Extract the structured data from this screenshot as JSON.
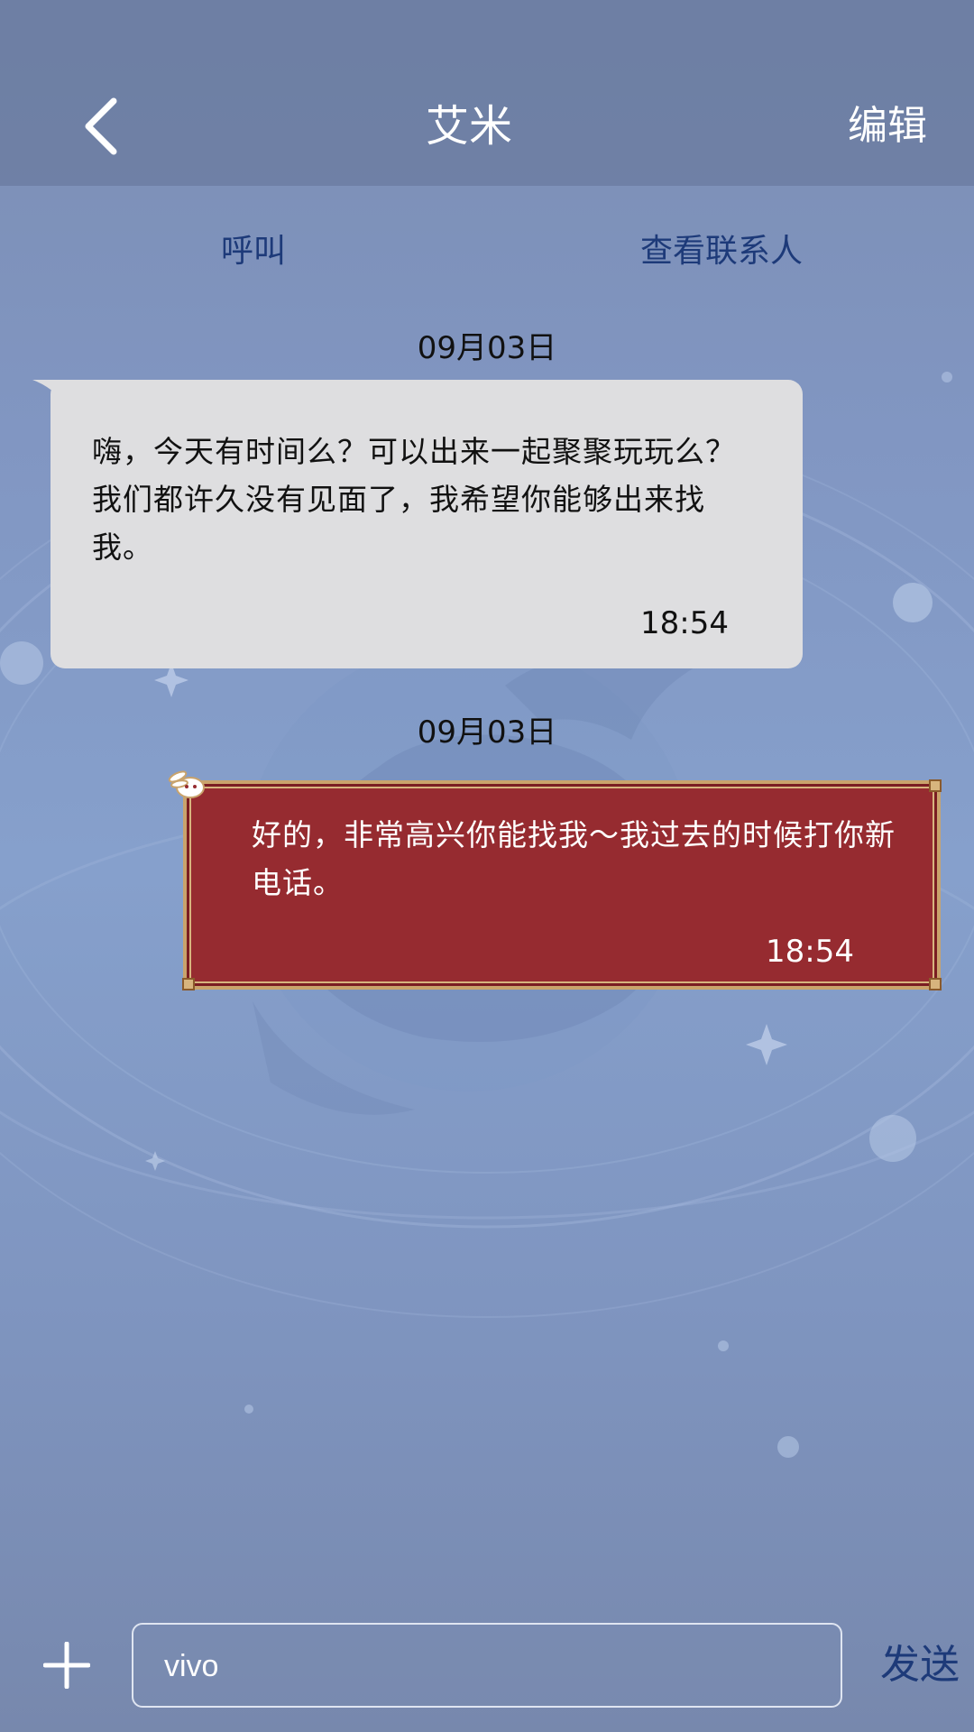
{
  "header": {
    "back_icon": "chevron-left-icon",
    "title": "艾米",
    "edit_label": "编辑",
    "background": "#697a9e"
  },
  "actions": {
    "call_label": "呼叫",
    "view_contact_label": "查看联系人",
    "color": "#1d3a79"
  },
  "messages": [
    {
      "date": "09月03日",
      "direction": "incoming",
      "text": "嗨，今天有时间么？可以出来一起聚聚玩玩么？我们都许久没有见面了，我希望你能够出来找我。",
      "time": "18:54",
      "bubble_color": "#dedee0"
    },
    {
      "date": "09月03日",
      "direction": "outgoing",
      "text": "好的，非常高兴你能找我～我过去的时候打你新电话。",
      "time": "18:54",
      "bubble_color": "#962b30",
      "frame_color": "#c9a36c",
      "decoration_icon": "bunny-icon"
    }
  ],
  "composer": {
    "add_icon": "plus-icon",
    "input_value": "vivo",
    "send_label": "发送"
  }
}
